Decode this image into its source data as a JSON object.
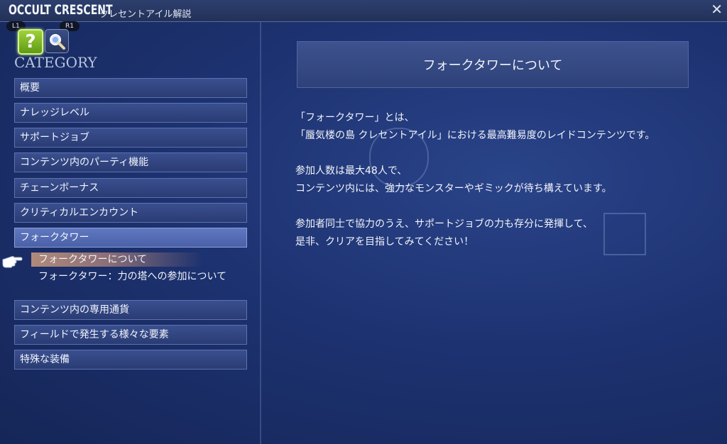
{
  "header": {
    "title": "OCCULT CRESCENT",
    "subtitle": "クレセントアイル解説",
    "close_glyph": "✕"
  },
  "hints": {
    "left": "L1",
    "right": "R1"
  },
  "icons": {
    "help": "question-icon",
    "search": "magnifier-icon",
    "close": "close-icon",
    "pointer": "hand-pointer-icon"
  },
  "sidebar": {
    "category_label": "CATEGORY",
    "items_top": [
      {
        "label": "概要"
      },
      {
        "label": "ナレッジレベル"
      },
      {
        "label": "サポートジョブ"
      },
      {
        "label": "コンテンツ内のパーティ機能"
      },
      {
        "label": "チェーンボーナス"
      },
      {
        "label": "クリティカルエンカウント"
      },
      {
        "label": "フォークタワー"
      }
    ],
    "sub_items": [
      {
        "label": "フォークタワーについて"
      },
      {
        "label": "フォークタワー：力の塔への参加について"
      }
    ],
    "items_bottom": [
      {
        "label": "コンテンツ内の専用通貨"
      },
      {
        "label": "フィールドで発生する様々な要素"
      },
      {
        "label": "特殊な装備"
      }
    ]
  },
  "content": {
    "title": "フォークタワーについて",
    "paragraphs": [
      [
        "「フォークタワー」とは、",
        "「蜃気楼の島 クレセントアイル」における最高難易度のレイドコンテンツです。"
      ],
      [
        "参加人数は最大48人で、",
        "コンテンツ内には、強力なモンスターやギミックが待ち構えています。"
      ],
      [
        "参加者同士で協力のうえ、サポートジョブの力も存分に発揮して、",
        "是非、クリアを目指してみてください！"
      ]
    ]
  },
  "colors": {
    "accent": "#5a73bd",
    "selected_sub": "#b08a7a",
    "help_icon": "#8cc63f"
  }
}
